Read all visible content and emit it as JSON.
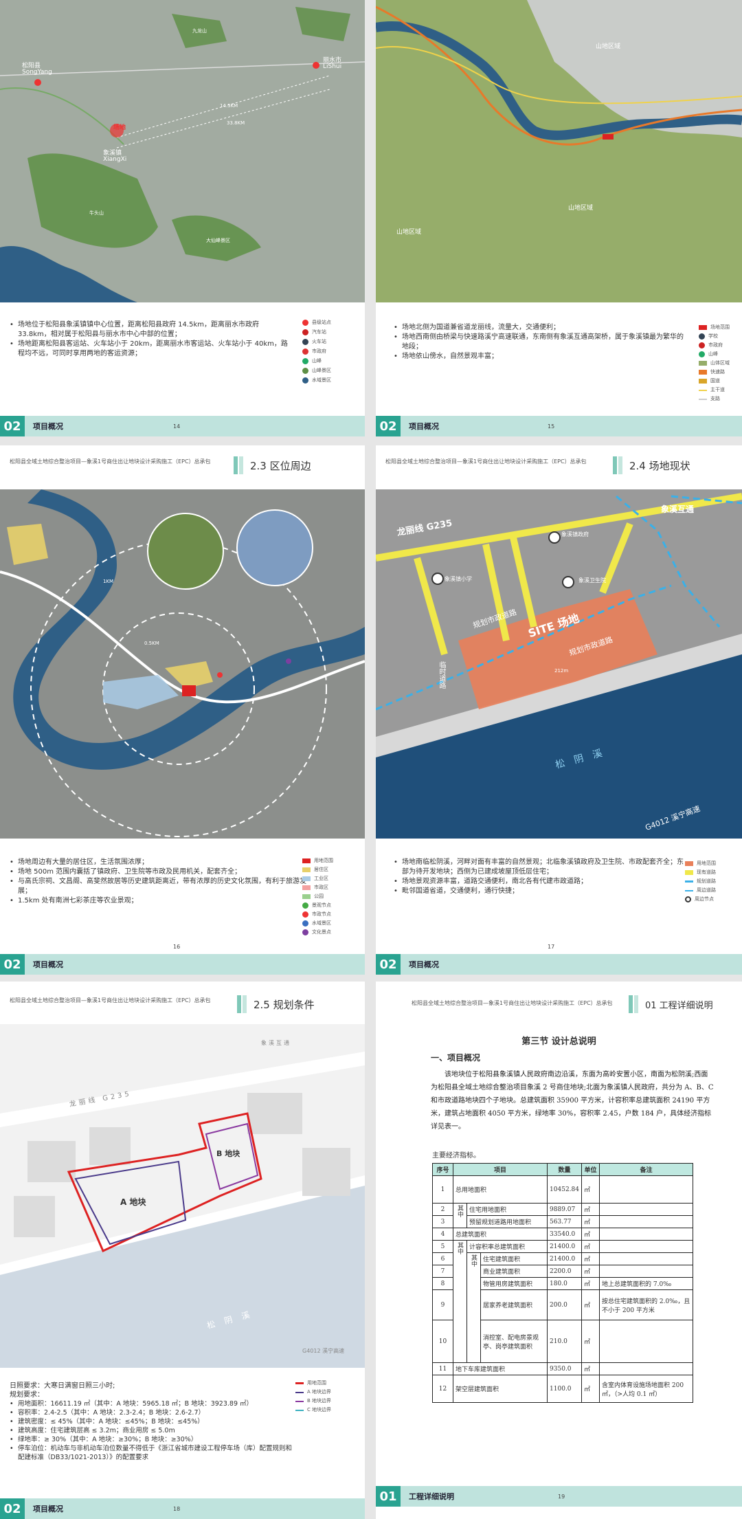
{
  "p14": {
    "bullets": [
      "场地位于松阳县象溪镇镇中心位置，距离松阳县政府 14.5km，距离丽水市政府 33.8km，相对属于松阳县与丽水市中心中部的位置；",
      "场地距离松阳县客运站、火车站小于 20km，距离丽水市客运站、火车站小于 40km，路程均不远，可同时享用两地的客运资源；"
    ],
    "legend": [
      "县级站点",
      "汽车站",
      "火车站",
      "市政府",
      "山峰",
      "山峰景区",
      "水域景区"
    ],
    "map_labels": {
      "songyang": "松阳县",
      "songyang_en": "SongYang",
      "xiangxi": "象溪镇",
      "xiangxi_en": "XiangXi",
      "lishui": "丽水市",
      "lishui_en": "LiShui",
      "site": "场地",
      "d1": "14.5KM",
      "d2": "33.8KM",
      "m1": "牛头山",
      "m2": "大仙峰景区",
      "m3": "九龙山"
    },
    "section_num": "02",
    "section_label": "项目概况",
    "page": "14"
  },
  "p15": {
    "bullets": [
      "场地北侧为国道兼省道龙丽线，流量大，交通便利；",
      "场地西南侧由桥梁与快速路溪宁高速联通，东南侧有象溪互通高架桥，属于象溪镇最为繁华的地段；",
      "场地依山傍水，自然景观丰富；"
    ],
    "legend": [
      "场地范围",
      "学校",
      "市政府",
      "山峰",
      "山体区域",
      "快速路",
      "国道",
      "主干道",
      "支路"
    ],
    "map_labels": {
      "a": "山地区域",
      "b": "山地区域",
      "c": "山地区域"
    },
    "section_num": "02",
    "section_label": "项目概况",
    "page": "15"
  },
  "p16": {
    "header": "松阳县全域土地综合整治项目—象溪1号商住出让地块设计采购施工（EPC）总承包",
    "section_title": "2.3 区位周边",
    "bullets": [
      "场地周边有大量的居住区，生活氛围浓厚；",
      "场地 500m 范围内囊括了镇政府、卫生院等市政及民用机关，配套齐全；",
      "与高氏宗祠、文昌阁、高斐然故居等历史建筑距离近，带有浓厚的历史文化氛围，有利于旅游发展；",
      "1.5km 处有南洲七彩茶庄等农业景观；"
    ],
    "legend": [
      "用地范围",
      "居住区",
      "工业区",
      "市政区",
      "公园",
      "景观节点",
      "市政节点",
      "水域景区",
      "文化景点"
    ],
    "rings": [
      "1KM",
      "0.5KM"
    ],
    "section_num": "02",
    "section_label": "项目概况",
    "page": "16"
  },
  "p17": {
    "header": "松阳县全域土地综合整治项目—象溪1号商住出让地块设计采购施工（EPC）总承包",
    "section_title": "2.4 场地现状",
    "bullets": [
      "场地南临松阴溪，河畔对面有丰富的自然景观；北临象溪镇政府及卫生院、市政配套齐全；东部为待开发地块；西侧为已建成坡屋顶低层住宅；",
      "场地景观资源丰富，道路交通便利，南北各有代建市政道路；",
      "毗邻国道省道，交通便利，通行快捷；"
    ],
    "legend": [
      "用地范围",
      "现有道路",
      "规划道路",
      "周边道路",
      "周边节点"
    ],
    "map_labels": {
      "g235": "龙丽线 G235",
      "interchange": "象溪互通",
      "site": "SITE 场地",
      "road1": "规划市政道路",
      "road2": "规划市政道路",
      "road3": "临时道路",
      "river": "松阴溪",
      "expressway": "G4012 溪宁高速",
      "gov": "象溪镇政府",
      "hospital": "象溪卫生院",
      "school": "象溪镇小学",
      "dim": "212m"
    },
    "section_num": "02",
    "section_label": "项目概况",
    "page": "17"
  },
  "p18": {
    "header": "松阳县全域土地综合整治项目—象溪1号商住出让地块设计采购施工（EPC）总承包",
    "section_title": "2.5 规划条件",
    "intro": [
      "日照要求：大寒日满窗日照三小时;",
      "规划要求："
    ],
    "bullets": [
      "用地面积：16611.19 ㎡（其中：A 地块：5965.18 ㎡；B 地块：3923.89 ㎡）",
      "容积率：2.4-2.5（其中：A 地块：2.3-2.4；B 地块：2.6-2.7）",
      "建筑密度：≤ 45%（其中：A 地块：≤45%；B 地块：≤45%）",
      "建筑高度：住宅建筑层高 ≤ 3.2m；商业用房 ≤ 5.0m",
      "绿地率：≥ 30%（其中：A 地块：≥30%；B 地块：≥30%）",
      "停车泊位：机动车与非机动车泊位数量不得低于《浙江省城市建设工程停车场（库）配置规则和配建标准（DB33/1021-2013）》的配置要求"
    ],
    "legend": [
      "用地范围",
      "A 地块边界",
      "B 地块边界",
      "C 地块边界"
    ],
    "map_labels": {
      "g235": "龙丽线 G235",
      "interchange": "象溪互通",
      "a": "A 地块",
      "b": "B 地块",
      "river": "松阴溪",
      "expressway": "G4012 溪宁高速"
    },
    "section_num": "02",
    "section_label": "项目概况",
    "page": "18"
  },
  "p19": {
    "header": "松阳县全域土地综合整治项目—象溪1号商住出让地块设计采购施工（EPC）总承包",
    "section_title": "01 工程详细说明",
    "title": "第三节 设计总说明",
    "h1": "一、项目概况",
    "para": "该地块位于松阳县象溪镇人民政府南边沿溪，东面为高岭安置小区，南面为松阴溪;西面为松阳县全域土地综合整治项目象溪 2 号商住地块;北面为象溪镇人民政府，共分为 A、B、C 和市政道路地块四个子地块。总建筑面积 35900 平方米，计容积率总建筑面积 24190 平方米，建筑占地面积 4050 平方米，绿地率 30%，容积率 2.45，户数 184 户，具体经济指标详见表一。",
    "sub": "主要经济指标。",
    "table_head": [
      "序号",
      "项目",
      "数量",
      "单位",
      "备注"
    ],
    "rows": [
      {
        "n": "1",
        "g": "",
        "s": "",
        "item": "总用地面积",
        "qty": "10452.84",
        "unit": "㎡",
        "note": ""
      },
      {
        "n": "2",
        "g": "其中",
        "s": "",
        "item": "住宅用地面积",
        "qty": "9889.07",
        "unit": "㎡",
        "note": ""
      },
      {
        "n": "3",
        "g": "",
        "s": "",
        "item": "预留规划道路用地面积",
        "qty": "563.77",
        "unit": "㎡",
        "note": ""
      },
      {
        "n": "4",
        "g": "",
        "s": "",
        "item": "总建筑面积",
        "qty": "33540.0",
        "unit": "㎡",
        "note": ""
      },
      {
        "n": "5",
        "g": "",
        "s": "",
        "item": "计容积率总建筑面积",
        "qty": "21400.0",
        "unit": "㎡",
        "note": ""
      },
      {
        "n": "6",
        "g": "",
        "s": "",
        "item": "住宅建筑面积",
        "qty": "21400.0",
        "unit": "㎡",
        "note": ""
      },
      {
        "n": "7",
        "g": "",
        "s": "",
        "item": "商业建筑面积",
        "qty": "2200.0",
        "unit": "㎡",
        "note": ""
      },
      {
        "n": "8",
        "g": "其中",
        "s": "其中",
        "item": "物管用房建筑面积",
        "qty": "180.0",
        "unit": "㎡",
        "note": "地上总建筑面积的 7.0‰"
      },
      {
        "n": "9",
        "g": "",
        "s": "",
        "item": "居家养老建筑面积",
        "qty": "200.0",
        "unit": "㎡",
        "note": "按总住宅建筑面积的 2.0‰，且不小于 200 平方米"
      },
      {
        "n": "10",
        "g": "",
        "s": "",
        "item": "消控室、配电房景观亭、岗亭建筑面积",
        "qty": "210.0",
        "unit": "㎡",
        "note": ""
      },
      {
        "n": "11",
        "g": "",
        "s": "",
        "item": "地下车库建筑面积",
        "qty": "9350.0",
        "unit": "㎡",
        "note": ""
      },
      {
        "n": "12",
        "g": "",
        "s": "",
        "item": "架空层建筑面积",
        "qty": "1100.0",
        "unit": "㎡",
        "note": "含室内体育设施场地面积 200 ㎡，（>人均 0.1 ㎡）"
      }
    ],
    "section_num": "01",
    "section_label": "工程详细说明",
    "page": "19"
  }
}
